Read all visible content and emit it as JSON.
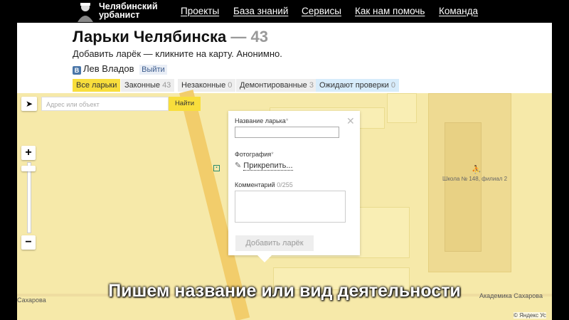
{
  "site": {
    "logo_line1": "Челябинский",
    "logo_line2": "урбанист",
    "nav": [
      "Проекты",
      "База знаний",
      "Сервисы",
      "Как нам помочь",
      "Команда"
    ]
  },
  "header": {
    "title": "Ларьки Челябинска",
    "title_count": "— 43",
    "subtitle": "Добавить ларёк — кликните на карту. Анонимно.",
    "user_name": "Лев Владов",
    "logout_label": "Выйти"
  },
  "filters": [
    {
      "label": "Все ларьки",
      "count": "",
      "state": "active"
    },
    {
      "label": "Законные",
      "count": "43",
      "state": ""
    },
    {
      "label": "Незаконные",
      "count": "0",
      "state": ""
    },
    {
      "label": "Демонтированные",
      "count": "3",
      "state": ""
    },
    {
      "label": "Ожидают проверки",
      "count": "0",
      "state": "pending"
    }
  ],
  "map": {
    "search_placeholder": "Адрес или объект",
    "search_button": "Найти",
    "zoom_in": "+",
    "zoom_out": "−",
    "school_label": "Школа № 148, филиал 2",
    "street_left": "Сахарова",
    "street_right": "Академика Сахарова",
    "attribution": "© Яндекс Ус"
  },
  "popup": {
    "name_label": "Название ларька",
    "name_required": "*",
    "name_value": "",
    "photo_label": "Фотография",
    "photo_required": "*",
    "attach_label": "Прикрепить...",
    "comment_label": "Комментарий",
    "comment_counter": "0/255",
    "comment_value": "",
    "submit_label": "Добавить ларёк"
  },
  "caption": "Пишем название или вид деятельности",
  "colors": {
    "accent": "#f8de3c",
    "map_bg": "#f6e9a9",
    "road": "#f2cd6b"
  }
}
